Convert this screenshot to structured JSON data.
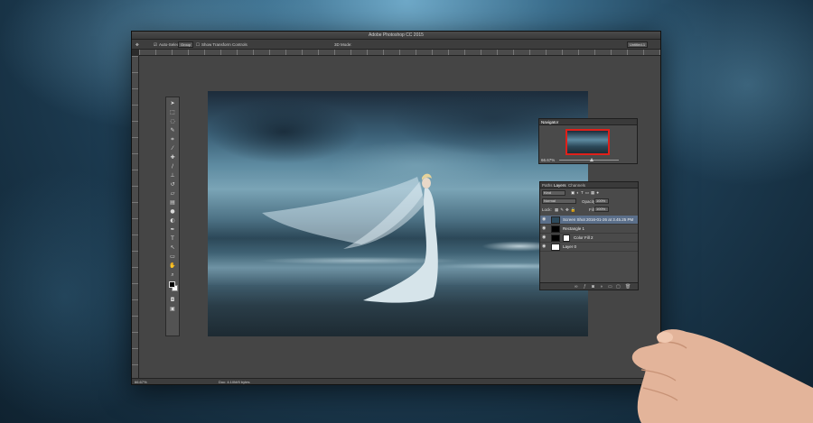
{
  "window": {
    "title": "Adobe Photoshop CC 2015"
  },
  "options_bar": {
    "auto_select_label": "Auto-Select:",
    "auto_select_value": "Group",
    "show_transform_label": "Show Transform Controls",
    "mode_3d_label": "3D Mode:",
    "workspace_value": "Untitled-1"
  },
  "status_bar": {
    "zoom": "66.67%",
    "doc_size": "Doc: 4.10M/0 bytes"
  },
  "navigator": {
    "tab_label": "Navigator",
    "zoom": "66.67%"
  },
  "layers_panel": {
    "tabs": [
      "Paths",
      "Layers",
      "Channels"
    ],
    "kind_filter": "Kind",
    "blend_mode": "Normal",
    "opacity_label": "Opacity:",
    "opacity_value": "100%",
    "lock_label": "Lock:",
    "fill_label": "Fill:",
    "fill_value": "100%",
    "layers": [
      {
        "name": "Screen Shot 2016-01-26 at 3.45.25 PM",
        "selected": true
      },
      {
        "name": "Rectangle 1",
        "selected": false
      },
      {
        "name": "Color Fill 2",
        "selected": false
      },
      {
        "name": "Layer 0",
        "selected": false
      }
    ]
  },
  "tools": [
    "move-tool",
    "marquee-tool",
    "lasso-tool",
    "quick-select-tool",
    "crop-tool",
    "eyedropper-tool",
    "healing-brush-tool",
    "brush-tool",
    "clone-stamp-tool",
    "history-brush-tool",
    "eraser-tool",
    "gradient-tool",
    "blur-tool",
    "dodge-tool",
    "pen-tool",
    "type-tool",
    "path-select-tool",
    "shape-tool",
    "hand-tool",
    "zoom-tool"
  ],
  "colors": {
    "foreground": "#000000",
    "background": "#ffffff",
    "nav_view_box": "#e0201a",
    "selected_layer": "#5b6f8a"
  }
}
